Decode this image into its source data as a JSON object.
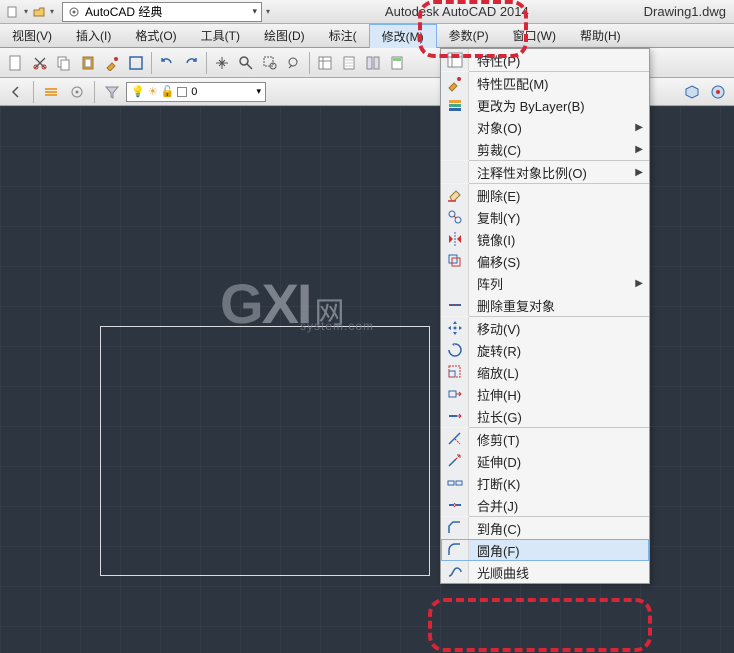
{
  "title_app": "Autodesk AutoCAD 2014",
  "title_file": "Drawing1.dwg",
  "workspace": "AutoCAD 经典",
  "menubar": [
    "视图(V)",
    "插入(I)",
    "格式(O)",
    "工具(T)",
    "绘图(D)",
    "标注(",
    "修改(M)",
    "参数(P)",
    "窗口(W)",
    "帮助(H)"
  ],
  "menubar_active_index": 6,
  "layer_name": "0",
  "dropdown": [
    {
      "icon": "properties",
      "label": "特性(P)",
      "submenu": false
    },
    {
      "sep": true
    },
    {
      "icon": "matchprop",
      "label": "特性匹配(M)",
      "submenu": false
    },
    {
      "icon": "bylayer",
      "label": "更改为 ByLayer(B)",
      "submenu": false
    },
    {
      "icon": "",
      "label": "对象(O)",
      "submenu": true
    },
    {
      "icon": "",
      "label": "剪裁(C)",
      "submenu": true
    },
    {
      "sep": true
    },
    {
      "icon": "",
      "label": "注释性对象比例(O)",
      "submenu": true
    },
    {
      "sep": true
    },
    {
      "icon": "erase",
      "label": "删除(E)",
      "submenu": false
    },
    {
      "icon": "copy",
      "label": "复制(Y)",
      "submenu": false
    },
    {
      "icon": "mirror",
      "label": "镜像(I)",
      "submenu": false
    },
    {
      "icon": "offset",
      "label": "偏移(S)",
      "submenu": false
    },
    {
      "icon": "",
      "label": "阵列",
      "submenu": true
    },
    {
      "icon": "deldup",
      "label": "删除重复对象",
      "submenu": false
    },
    {
      "sep": true
    },
    {
      "icon": "move",
      "label": "移动(V)",
      "submenu": false
    },
    {
      "icon": "rotate",
      "label": "旋转(R)",
      "submenu": false
    },
    {
      "icon": "scale",
      "label": "缩放(L)",
      "submenu": false
    },
    {
      "icon": "stretch",
      "label": "拉伸(H)",
      "submenu": false
    },
    {
      "icon": "lengthen",
      "label": "拉长(G)",
      "submenu": false
    },
    {
      "sep": true
    },
    {
      "icon": "trim",
      "label": "修剪(T)",
      "submenu": false
    },
    {
      "icon": "extend",
      "label": "延伸(D)",
      "submenu": false
    },
    {
      "icon": "break",
      "label": "打断(K)",
      "submenu": false
    },
    {
      "icon": "join",
      "label": "合并(J)",
      "submenu": false
    },
    {
      "sep": true
    },
    {
      "icon": "chamfer",
      "label": "到角(C)",
      "submenu": false
    },
    {
      "icon": "fillet",
      "label": "圆角(F)",
      "submenu": false,
      "highlight": true
    },
    {
      "icon": "blend",
      "label": "光顺曲线",
      "submenu": false
    }
  ],
  "watermark": {
    "big1": "G",
    "big2": "XI",
    "text": "网",
    "sub": "system.com"
  }
}
